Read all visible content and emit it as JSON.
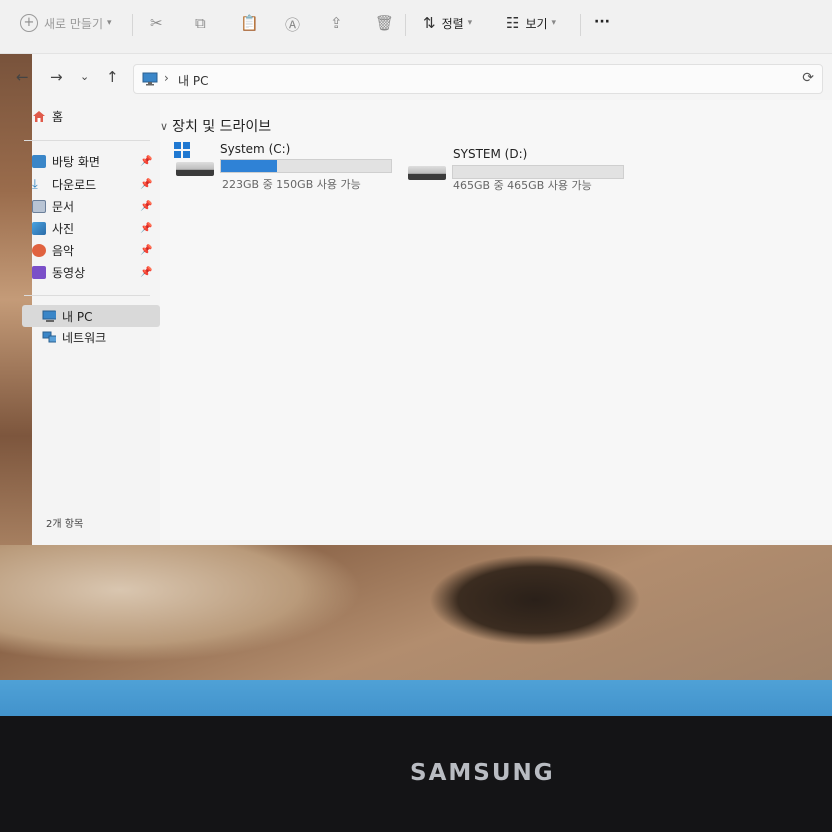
{
  "toolbar": {
    "new_label": "새로 만들기",
    "sort_label": "정렬",
    "view_label": "보기",
    "more_label": "···"
  },
  "address": {
    "path": "내 PC"
  },
  "sidebar": {
    "home": "홈",
    "quick_access": [
      {
        "label": "바탕 화면",
        "icon": "desktop-icon"
      },
      {
        "label": "다운로드",
        "icon": "download-icon"
      },
      {
        "label": "문서",
        "icon": "document-icon"
      },
      {
        "label": "사진",
        "icon": "pictures-icon"
      },
      {
        "label": "음악",
        "icon": "music-icon"
      },
      {
        "label": "동영상",
        "icon": "video-icon"
      }
    ],
    "this_pc": "내 PC",
    "network": "네트워크"
  },
  "main": {
    "section_title": "장치 및 드라이브",
    "drives": [
      {
        "name": "System (C:)",
        "size_text": "223GB 중 150GB 사용 가능",
        "used_fraction": 0.33
      },
      {
        "name": "SYSTEM (D:)",
        "size_text": "465GB 중 465GB 사용 가능",
        "used_fraction": 0.0
      }
    ]
  },
  "status": {
    "item_count": "2개 항목"
  },
  "device": {
    "brand": "SAMSUNG"
  },
  "colors": {
    "accent": "#2f82d6",
    "taskbar": "#4fa1d6"
  }
}
